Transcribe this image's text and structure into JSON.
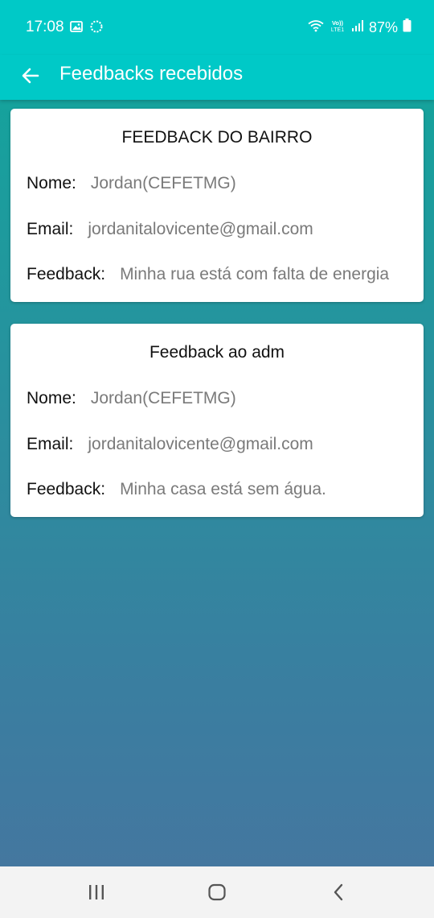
{
  "status_bar": {
    "time": "17:08",
    "battery": "87%",
    "icons": [
      "image-icon",
      "sync-icon",
      "wifi-icon",
      "volte-icon",
      "signal-icon",
      "battery-icon"
    ]
  },
  "app_bar": {
    "title": "Feedbacks recebidos",
    "back_icon": "arrow-back-icon"
  },
  "feedbacks": [
    {
      "title": "FEEDBACK DO BAIRRO",
      "nome_label": "Nome:",
      "nome": "Jordan(CEFETMG)",
      "email_label": "Email:",
      "email": "jordanitalovicente@gmail.com",
      "feedback_label": "Feedback:",
      "feedback": "Minha rua está com falta de energia"
    },
    {
      "title": "Feedback ao adm",
      "nome_label": "Nome:",
      "nome": "Jordan(CEFETMG)",
      "email_label": "Email:",
      "email": "jordanitalovicente@gmail.com",
      "feedback_label": "Feedback:",
      "feedback": "Minha casa está sem água."
    }
  ],
  "nav_bar": {
    "icons": [
      "recents-icon",
      "home-icon",
      "back-icon"
    ]
  },
  "colors": {
    "app_bar": "#00c9c7",
    "background_top": "#0fa89c",
    "background_bottom": "#47759f",
    "card": "#ffffff",
    "label_text": "#111111",
    "value_text": "#7a7a7a"
  }
}
